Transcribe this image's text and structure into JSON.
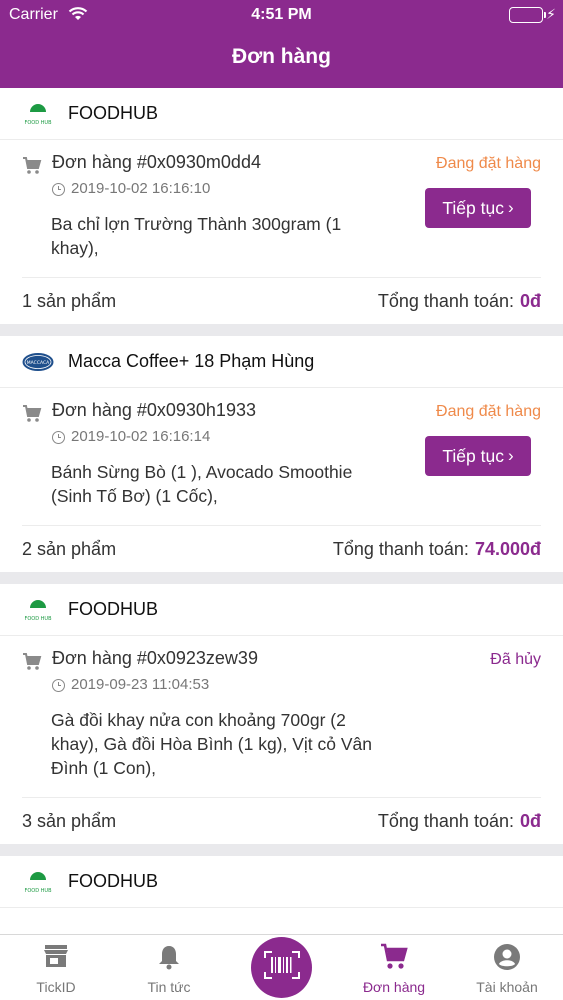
{
  "status_bar": {
    "carrier": "Carrier",
    "time": "4:51 PM"
  },
  "nav": {
    "title": "Đơn hàng"
  },
  "orders": [
    {
      "shop": "FOODHUB",
      "order_id": "Đơn hàng #0x0930m0dd4",
      "status": "Đang đặt hàng",
      "time": "2019-10-02 16:16:10",
      "items": "Ba chỉ lợn Trường Thành 300gram (1 khay),",
      "continue_label": "Tiếp tục",
      "count": "1 sản phẩm",
      "total_label": "Tổng thanh toán:",
      "total_value": "0đ"
    },
    {
      "shop": "Macca Coffee+ 18 Phạm Hùng",
      "order_id": "Đơn hàng #0x0930h1933",
      "status": "Đang đặt hàng",
      "time": "2019-10-02 16:16:14",
      "items": "Bánh Sừng Bò (1 ), Avocado Smoothie (Sinh Tố Bơ) (1 Cốc),",
      "continue_label": "Tiếp tục",
      "count": "2 sản phẩm",
      "total_label": "Tổng thanh toán:",
      "total_value": "74.000đ"
    },
    {
      "shop": "FOODHUB",
      "order_id": "Đơn hàng #0x0923zew39",
      "status": "Đã hủy",
      "time": "2019-09-23 11:04:53",
      "items": "Gà đồi khay nửa con  khoảng 700gr (2 khay), Gà đồi Hòa Bình (1 kg), Vịt cỏ Vân Đình (1 Con),",
      "count": "3 sản phẩm",
      "total_label": "Tổng thanh toán:",
      "total_value": "0đ"
    },
    {
      "shop": "FOODHUB"
    }
  ],
  "logos": {
    "foodhub_text": "FOOD HUB",
    "macca_text": "MACCACA"
  },
  "tabs": [
    {
      "label": "TickID",
      "icon": "store-icon"
    },
    {
      "label": "Tin tức",
      "icon": "bell-icon"
    },
    {
      "label": "Đơn hàng",
      "icon": "cart-icon"
    },
    {
      "label": "Tài khoản",
      "icon": "account-icon"
    }
  ],
  "colors": {
    "brand": "#8b2a8e",
    "status_pending": "#ef8a4a",
    "status_cancelled": "#8b2a8e"
  }
}
